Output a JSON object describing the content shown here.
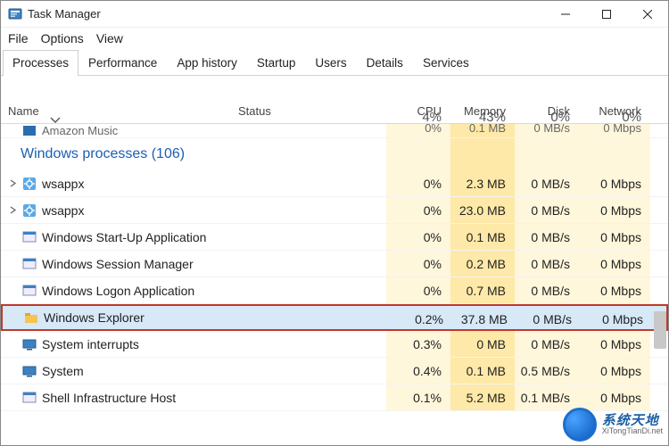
{
  "window": {
    "title": "Task Manager",
    "controls": {
      "minimize": "—",
      "maximize": "☐",
      "close": "✕"
    }
  },
  "menu": {
    "file": "File",
    "options": "Options",
    "view": "View"
  },
  "tabs": {
    "processes": "Processes",
    "performance": "Performance",
    "app_history": "App history",
    "startup": "Startup",
    "users": "Users",
    "details": "Details",
    "services": "Services"
  },
  "columns": {
    "name": "Name",
    "status": "Status",
    "cpu": {
      "percent": "4%",
      "label": "CPU"
    },
    "memory": {
      "percent": "43%",
      "label": "Memory"
    },
    "disk": {
      "percent": "0%",
      "label": "Disk"
    },
    "network": {
      "percent": "0%",
      "label": "Network"
    }
  },
  "cut_row": {
    "name": "Amazon Music",
    "cpu": "0%",
    "mem": "0.1 MB",
    "disk": "0 MB/s",
    "net": "0 Mbps"
  },
  "group": {
    "label": "Windows processes (106)"
  },
  "rows": [
    {
      "expandable": true,
      "icon": "gear",
      "name": "wsappx",
      "cpu": "0%",
      "mem": "2.3 MB",
      "disk": "0 MB/s",
      "net": "0 Mbps"
    },
    {
      "expandable": true,
      "icon": "gear",
      "name": "wsappx",
      "cpu": "0%",
      "mem": "23.0 MB",
      "disk": "0 MB/s",
      "net": "0 Mbps"
    },
    {
      "expandable": false,
      "icon": "app",
      "name": "Windows Start-Up Application",
      "cpu": "0%",
      "mem": "0.1 MB",
      "disk": "0 MB/s",
      "net": "0 Mbps"
    },
    {
      "expandable": false,
      "icon": "app",
      "name": "Windows Session Manager",
      "cpu": "0%",
      "mem": "0.2 MB",
      "disk": "0 MB/s",
      "net": "0 Mbps"
    },
    {
      "expandable": false,
      "icon": "app",
      "name": "Windows Logon Application",
      "cpu": "0%",
      "mem": "0.7 MB",
      "disk": "0 MB/s",
      "net": "0 Mbps"
    },
    {
      "expandable": false,
      "icon": "explorer",
      "name": "Windows Explorer",
      "cpu": "0.2%",
      "mem": "37.8 MB",
      "disk": "0 MB/s",
      "net": "0 Mbps",
      "highlight": true
    },
    {
      "expandable": false,
      "icon": "sys",
      "name": "System interrupts",
      "cpu": "0.3%",
      "mem": "0 MB",
      "disk": "0 MB/s",
      "net": "0 Mbps"
    },
    {
      "expandable": false,
      "icon": "sys",
      "name": "System",
      "cpu": "0.4%",
      "mem": "0.1 MB",
      "disk": "0.5 MB/s",
      "net": "0 Mbps"
    },
    {
      "expandable": false,
      "icon": "app",
      "name": "Shell Infrastructure Host",
      "cpu": "0.1%",
      "mem": "5.2 MB",
      "disk": "0.1 MB/s",
      "net": "0 Mbps"
    }
  ],
  "watermark": {
    "cn": "系统天地",
    "url": "XiTongTianDi.net"
  }
}
